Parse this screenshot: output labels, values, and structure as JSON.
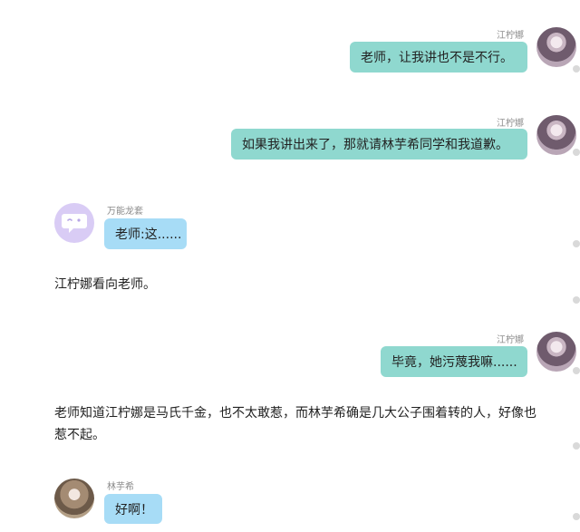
{
  "messages": [
    {
      "name": "江柠娜",
      "text": "老师，让我讲也不是不行。"
    },
    {
      "name": "江柠娜",
      "text": "如果我讲出来了，那就请林芋希同学和我道歉。"
    },
    {
      "name": "万能龙套",
      "text": "老师:这......"
    },
    {
      "narration": "江柠娜看向老师。"
    },
    {
      "name": "江柠娜",
      "text": "毕竟，她污蔑我嘛......"
    },
    {
      "narration_lines": [
        "老师知道江柠娜是马氏千金，也不太敢惹，而林芋希确是几大公子围着转的人，好像也",
        "惹不起。"
      ]
    },
    {
      "name": "林芋希",
      "text": "好啊！"
    }
  ],
  "icons": {
    "system_avatar": "chat-bubble-face-icon",
    "girl_avatar": "girl-portrait-avatar"
  },
  "colors": {
    "right_bubble": "#8fd8cf",
    "left_bubble": "#a7dcf6",
    "system_avatar_bg": "#d9ccf5"
  }
}
